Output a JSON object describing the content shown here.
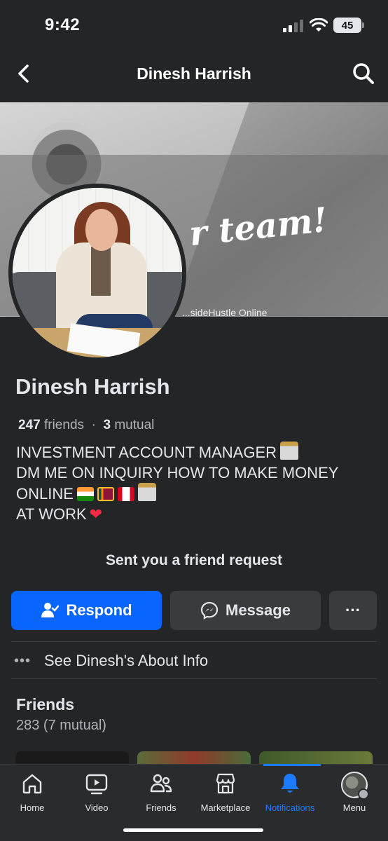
{
  "status_bar": {
    "time": "9:42",
    "battery": "45"
  },
  "header": {
    "title": "Dinesh Harrish"
  },
  "cover": {
    "script_text": "r team!",
    "small_text": "...sideHustle Online"
  },
  "profile": {
    "name": "Dinesh Harrish",
    "friends_count": "247",
    "friends_word": "friends",
    "separator": "·",
    "mutual_count": "3",
    "mutual_word": "mutual",
    "bio": {
      "line1": "INVESTMENT ACCOUNT MANAGER",
      "line2": "DM ME ON INQUIRY HOW TO MAKE MONEY",
      "line3": "ONLINE",
      "line4": "AT WORK"
    }
  },
  "request": {
    "title": "Sent you a friend request"
  },
  "actions": {
    "respond": "Respond",
    "message": "Message",
    "more": "···"
  },
  "about": {
    "dots": "•••",
    "label": "See Dinesh's About Info"
  },
  "friends": {
    "title": "Friends",
    "count": "283 (7 mutual)"
  },
  "tabs": [
    {
      "label": "Home",
      "icon": "home-icon"
    },
    {
      "label": "Video",
      "icon": "video-icon"
    },
    {
      "label": "Friends",
      "icon": "friends-icon"
    },
    {
      "label": "Marketplace",
      "icon": "marketplace-icon"
    },
    {
      "label": "Notifications",
      "icon": "bell-icon"
    },
    {
      "label": "Menu",
      "icon": "menu-avatar-icon"
    }
  ],
  "colors": {
    "accent": "#0866ff",
    "active_tab": "#1d7bff",
    "background": "#242526",
    "button_gray": "#3a3b3c"
  }
}
